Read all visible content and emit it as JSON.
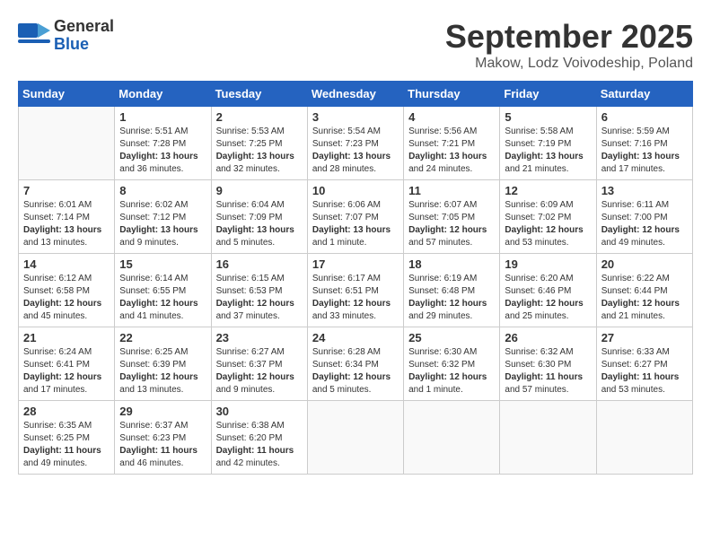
{
  "header": {
    "logo_line1": "General",
    "logo_line2": "Blue",
    "month_title": "September 2025",
    "subtitle": "Makow, Lodz Voivodeship, Poland"
  },
  "weekdays": [
    "Sunday",
    "Monday",
    "Tuesday",
    "Wednesday",
    "Thursday",
    "Friday",
    "Saturday"
  ],
  "weeks": [
    [
      {
        "day": "",
        "info": ""
      },
      {
        "day": "1",
        "info": "Sunrise: 5:51 AM\nSunset: 7:28 PM\nDaylight: 13 hours\nand 36 minutes."
      },
      {
        "day": "2",
        "info": "Sunrise: 5:53 AM\nSunset: 7:25 PM\nDaylight: 13 hours\nand 32 minutes."
      },
      {
        "day": "3",
        "info": "Sunrise: 5:54 AM\nSunset: 7:23 PM\nDaylight: 13 hours\nand 28 minutes."
      },
      {
        "day": "4",
        "info": "Sunrise: 5:56 AM\nSunset: 7:21 PM\nDaylight: 13 hours\nand 24 minutes."
      },
      {
        "day": "5",
        "info": "Sunrise: 5:58 AM\nSunset: 7:19 PM\nDaylight: 13 hours\nand 21 minutes."
      },
      {
        "day": "6",
        "info": "Sunrise: 5:59 AM\nSunset: 7:16 PM\nDaylight: 13 hours\nand 17 minutes."
      }
    ],
    [
      {
        "day": "7",
        "info": "Sunrise: 6:01 AM\nSunset: 7:14 PM\nDaylight: 13 hours\nand 13 minutes."
      },
      {
        "day": "8",
        "info": "Sunrise: 6:02 AM\nSunset: 7:12 PM\nDaylight: 13 hours\nand 9 minutes."
      },
      {
        "day": "9",
        "info": "Sunrise: 6:04 AM\nSunset: 7:09 PM\nDaylight: 13 hours\nand 5 minutes."
      },
      {
        "day": "10",
        "info": "Sunrise: 6:06 AM\nSunset: 7:07 PM\nDaylight: 13 hours\nand 1 minute."
      },
      {
        "day": "11",
        "info": "Sunrise: 6:07 AM\nSunset: 7:05 PM\nDaylight: 12 hours\nand 57 minutes."
      },
      {
        "day": "12",
        "info": "Sunrise: 6:09 AM\nSunset: 7:02 PM\nDaylight: 12 hours\nand 53 minutes."
      },
      {
        "day": "13",
        "info": "Sunrise: 6:11 AM\nSunset: 7:00 PM\nDaylight: 12 hours\nand 49 minutes."
      }
    ],
    [
      {
        "day": "14",
        "info": "Sunrise: 6:12 AM\nSunset: 6:58 PM\nDaylight: 12 hours\nand 45 minutes."
      },
      {
        "day": "15",
        "info": "Sunrise: 6:14 AM\nSunset: 6:55 PM\nDaylight: 12 hours\nand 41 minutes."
      },
      {
        "day": "16",
        "info": "Sunrise: 6:15 AM\nSunset: 6:53 PM\nDaylight: 12 hours\nand 37 minutes."
      },
      {
        "day": "17",
        "info": "Sunrise: 6:17 AM\nSunset: 6:51 PM\nDaylight: 12 hours\nand 33 minutes."
      },
      {
        "day": "18",
        "info": "Sunrise: 6:19 AM\nSunset: 6:48 PM\nDaylight: 12 hours\nand 29 minutes."
      },
      {
        "day": "19",
        "info": "Sunrise: 6:20 AM\nSunset: 6:46 PM\nDaylight: 12 hours\nand 25 minutes."
      },
      {
        "day": "20",
        "info": "Sunrise: 6:22 AM\nSunset: 6:44 PM\nDaylight: 12 hours\nand 21 minutes."
      }
    ],
    [
      {
        "day": "21",
        "info": "Sunrise: 6:24 AM\nSunset: 6:41 PM\nDaylight: 12 hours\nand 17 minutes."
      },
      {
        "day": "22",
        "info": "Sunrise: 6:25 AM\nSunset: 6:39 PM\nDaylight: 12 hours\nand 13 minutes."
      },
      {
        "day": "23",
        "info": "Sunrise: 6:27 AM\nSunset: 6:37 PM\nDaylight: 12 hours\nand 9 minutes."
      },
      {
        "day": "24",
        "info": "Sunrise: 6:28 AM\nSunset: 6:34 PM\nDaylight: 12 hours\nand 5 minutes."
      },
      {
        "day": "25",
        "info": "Sunrise: 6:30 AM\nSunset: 6:32 PM\nDaylight: 12 hours\nand 1 minute."
      },
      {
        "day": "26",
        "info": "Sunrise: 6:32 AM\nSunset: 6:30 PM\nDaylight: 11 hours\nand 57 minutes."
      },
      {
        "day": "27",
        "info": "Sunrise: 6:33 AM\nSunset: 6:27 PM\nDaylight: 11 hours\nand 53 minutes."
      }
    ],
    [
      {
        "day": "28",
        "info": "Sunrise: 6:35 AM\nSunset: 6:25 PM\nDaylight: 11 hours\nand 49 minutes."
      },
      {
        "day": "29",
        "info": "Sunrise: 6:37 AM\nSunset: 6:23 PM\nDaylight: 11 hours\nand 46 minutes."
      },
      {
        "day": "30",
        "info": "Sunrise: 6:38 AM\nSunset: 6:20 PM\nDaylight: 11 hours\nand 42 minutes."
      },
      {
        "day": "",
        "info": ""
      },
      {
        "day": "",
        "info": ""
      },
      {
        "day": "",
        "info": ""
      },
      {
        "day": "",
        "info": ""
      }
    ]
  ]
}
